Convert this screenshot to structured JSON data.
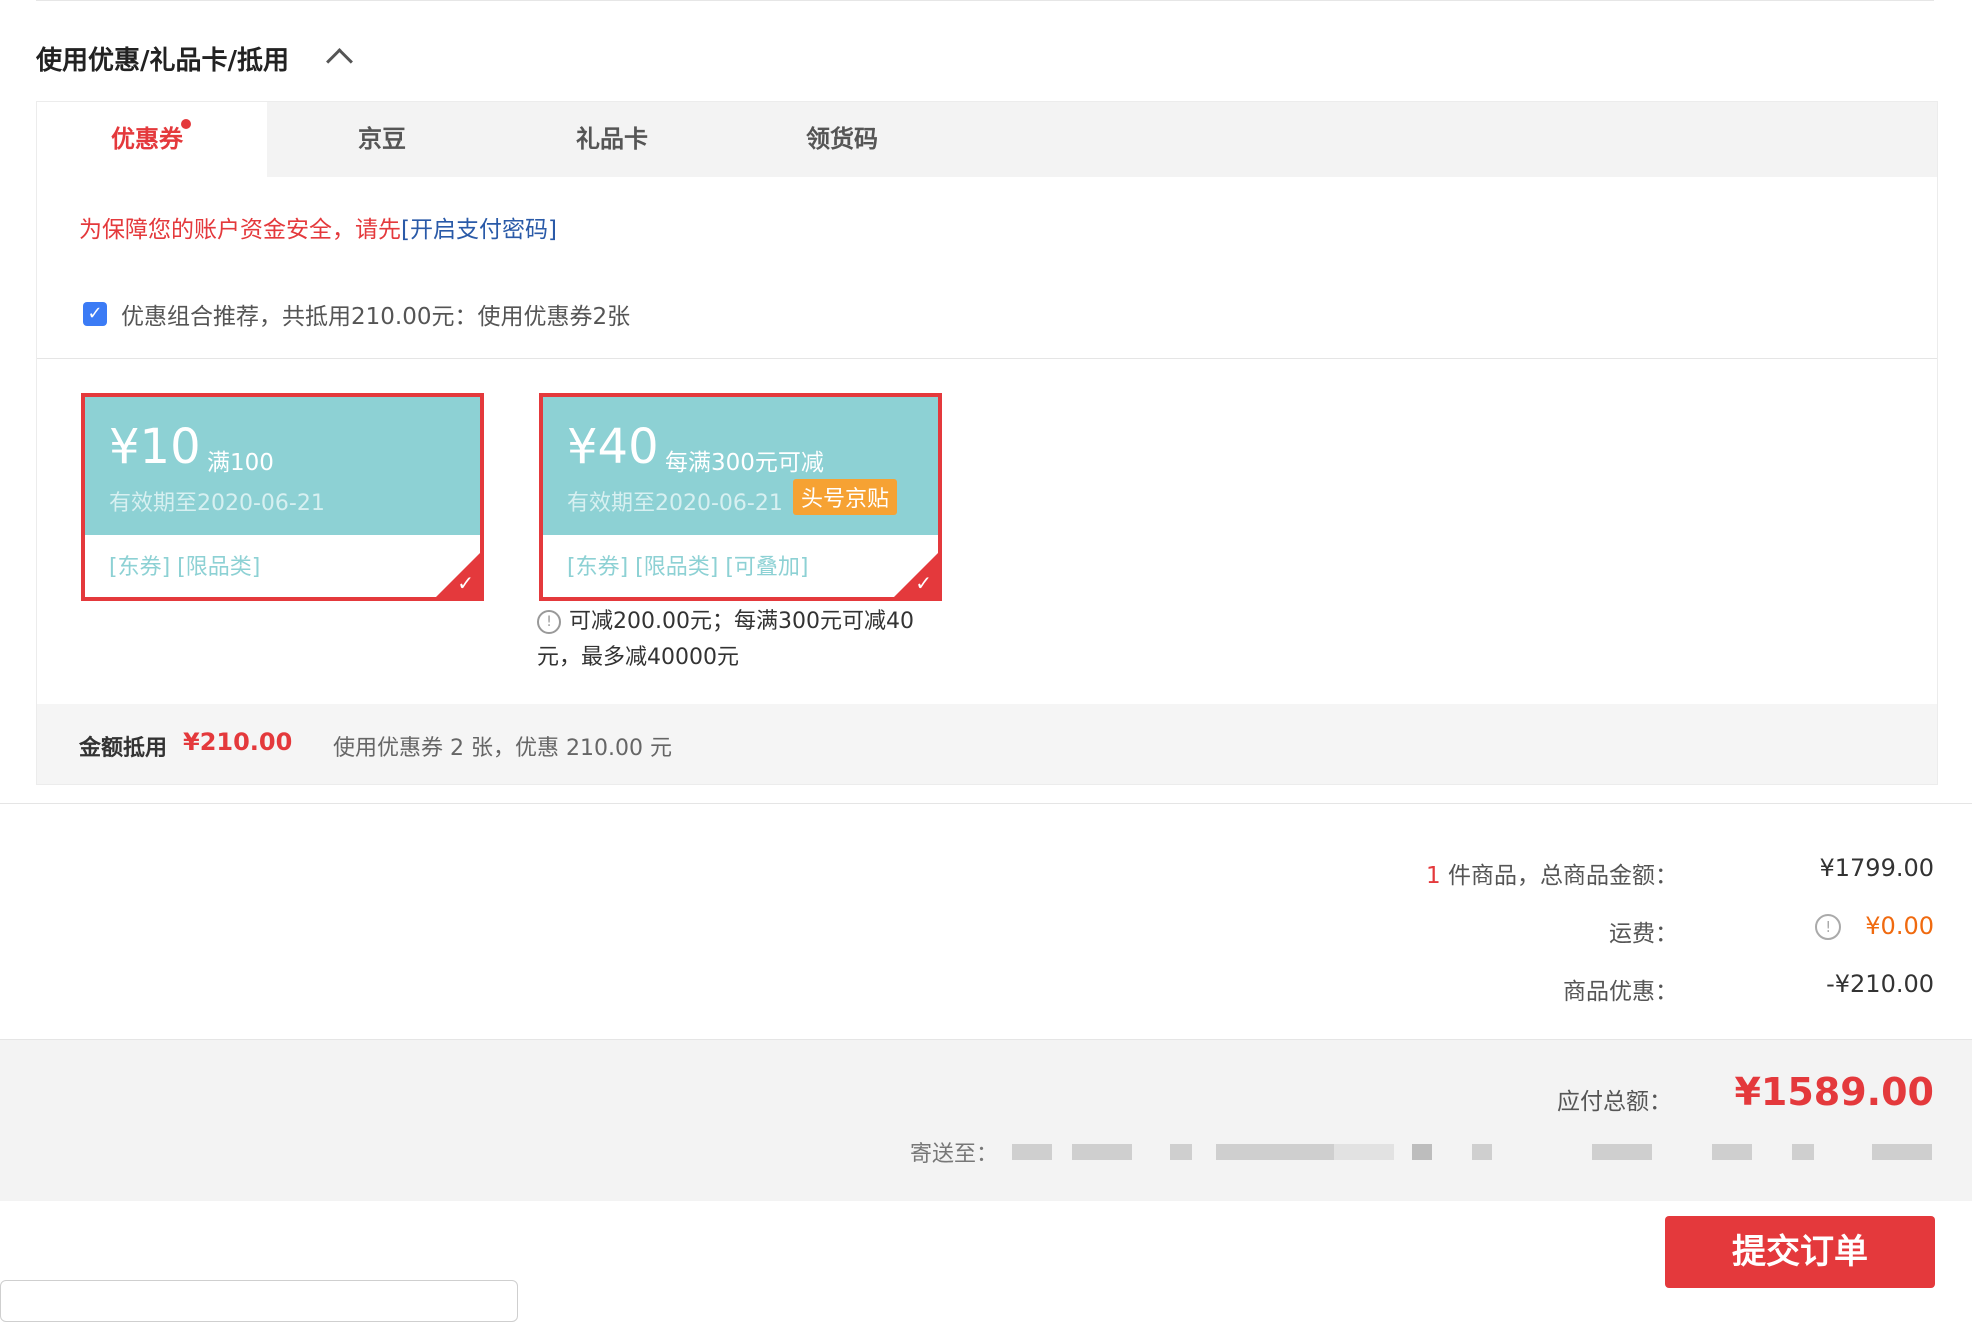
{
  "section": {
    "title": "使用优惠/礼品卡/抵用"
  },
  "tabs": [
    {
      "label": "优惠券"
    },
    {
      "label": "京豆"
    },
    {
      "label": "礼品卡"
    },
    {
      "label": "领货码"
    }
  ],
  "warning": {
    "text": "为保障您的账户资金安全，请先",
    "link": "[开启支付密码]"
  },
  "combo": {
    "text": "优惠组合推荐，共抵用210.00元：使用优惠券2张",
    "checked": true
  },
  "coupons": [
    {
      "amount": "¥10",
      "condition": "满100",
      "expiry": "有效期至2020-06-21",
      "badge": "",
      "tags": "[东券]  [限品类]"
    },
    {
      "amount": "¥40",
      "condition": "每满300元可减",
      "expiry": "有效期至2020-06-21",
      "badge": "头号京贴",
      "tags": "[东券]  [限品类]  [可叠加]"
    }
  ],
  "coupon_note": "可减200.00元；每满300元可减40元，最多减40000元",
  "summary": {
    "label": "金额抵用",
    "amount": "¥210.00",
    "desc": "使用优惠券 2 张，优惠 210.00 元"
  },
  "totals": {
    "count": "1",
    "goods_label": " 件商品，总商品金额：",
    "goods_value": "¥1799.00",
    "shipping_label": "运费：",
    "shipping_value": "¥0.00",
    "discount_label": "商品优惠：",
    "discount_value": "-¥210.00"
  },
  "payable": {
    "label": "应付总额：",
    "value": "¥1589.00",
    "ship_to_label": "寄送至："
  },
  "submit": {
    "label": "提交订单"
  },
  "colors": {
    "accent": "#e4393c",
    "coupon": "#8dd1d4",
    "badge": "#f6a233"
  }
}
